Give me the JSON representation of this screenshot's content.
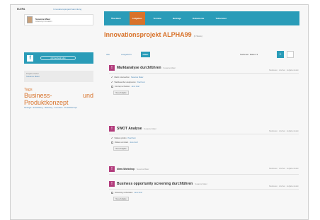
{
  "topstrip": {
    "logo": "ELEPA",
    "link": "Innovationsprojekt-Sammlung"
  },
  "user": {
    "name": "Susanne Maier",
    "sub": "Abteilung Innovation"
  },
  "nav": [
    "Überblick",
    "Aufgaben",
    "Termine",
    "Beiträge",
    "Dokumente",
    "Teilnehmer"
  ],
  "sidebar": {
    "facebook_label": "Auf Facebook teilen",
    "owner_label": "Projekt-Inhaber",
    "owner_value": "Susanne Maier",
    "tags_title": "Tags",
    "tag_big_left": "Business-",
    "tag_big_right": "und",
    "tag_big_2": "Produktkonzept",
    "tag_links": "Strategie · Entwicklung · Marketing · Innovation · Produktkonzept"
  },
  "main": {
    "title": "Innovationsprojekt ALPHA99",
    "title_meta": "(6 Tasks)",
    "tabs": [
      "Alle",
      "Ausgeführt",
      "Offen"
    ],
    "sort_label": "Sortieren: Datum ▾",
    "sq_icon": "+"
  },
  "tasks": [
    {
      "title": "Marktanalyse durchführen",
      "meta": "Susanne Maier",
      "right": "Bearbeiten · Löschen · Aufgabe ändern",
      "items": [
        {
          "checked": true,
          "text": "Markt untersuchen",
          "note": "Susanne Maier"
        },
        {
          "checked": true,
          "text": "Wettbewerber analysieren",
          "note": "Paul Kern"
        },
        {
          "checked": false,
          "text": "Konzept schreiben",
          "note": "Jens Graf"
        }
      ],
      "add": "Neue Aufgabe"
    },
    {
      "title": "SWOT Analyse",
      "meta": "Susanne Maier",
      "right": "Bearbeiten · Löschen · Aufgabe ändern",
      "items": [
        {
          "checked": true,
          "text": "Stärken prüfen",
          "note": "Paul Kern"
        },
        {
          "checked": false,
          "text": "Risiken ermitteln",
          "note": "Jens Graf"
        }
      ],
      "add": "Neue Aufgabe"
    },
    {
      "title": "Ideen-Workshop",
      "meta": "Susanne Maier",
      "right": "Bearbeiten · Löschen · Aufgabe ändern",
      "items": [],
      "add": ""
    },
    {
      "title": "Business opportunity screening durchführen",
      "meta": "Susanne Maier",
      "right": "Bearbeiten · Löschen · Aufgabe ändern",
      "items": [
        {
          "checked": false,
          "text": "Screening vorbereiten",
          "note": "Jens Graf"
        }
      ],
      "add": "Neue Aufgabe"
    }
  ]
}
